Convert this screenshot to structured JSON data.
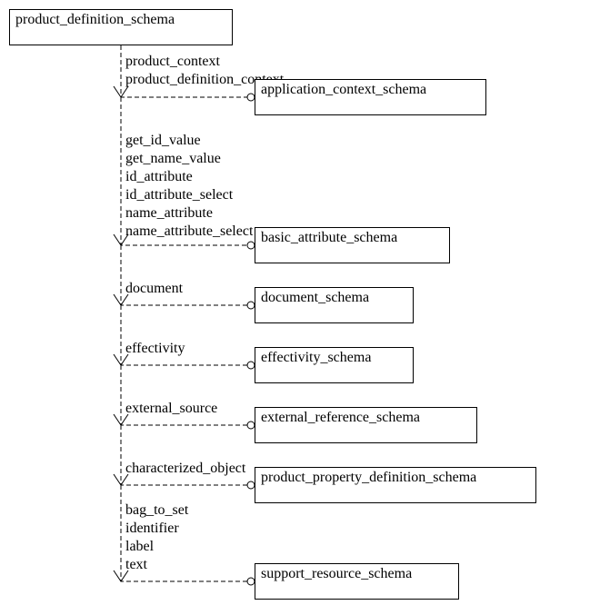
{
  "root": {
    "title": "product_definition_schema"
  },
  "groups": [
    {
      "labels": [
        "product_context",
        "product_definition_context"
      ],
      "target": "application_context_schema"
    },
    {
      "labels": [
        "get_id_value",
        "get_name_value",
        "id_attribute",
        "id_attribute_select",
        "name_attribute",
        "name_attribute_select"
      ],
      "target": "basic_attribute_schema"
    },
    {
      "labels": [
        "document"
      ],
      "target": "document_schema"
    },
    {
      "labels": [
        "effectivity"
      ],
      "target": "effectivity_schema"
    },
    {
      "labels": [
        "external_source"
      ],
      "target": "external_reference_schema"
    },
    {
      "labels": [
        "characterized_object"
      ],
      "target": "product_property_definition_schema"
    },
    {
      "labels": [
        "bag_to_set",
        "identifier",
        "label",
        "text"
      ],
      "target": "support_resource_schema"
    }
  ],
  "chart_data": {
    "type": "diagram",
    "description": "EXPRESS-G schema reference diagram",
    "source_schema": "product_definition_schema",
    "references": [
      {
        "target_schema": "application_context_schema",
        "items": [
          "product_context",
          "product_definition_context"
        ]
      },
      {
        "target_schema": "basic_attribute_schema",
        "items": [
          "get_id_value",
          "get_name_value",
          "id_attribute",
          "id_attribute_select",
          "name_attribute",
          "name_attribute_select"
        ]
      },
      {
        "target_schema": "document_schema",
        "items": [
          "document"
        ]
      },
      {
        "target_schema": "effectivity_schema",
        "items": [
          "effectivity"
        ]
      },
      {
        "target_schema": "external_reference_schema",
        "items": [
          "external_source"
        ]
      },
      {
        "target_schema": "product_property_definition_schema",
        "items": [
          "characterized_object"
        ]
      },
      {
        "target_schema": "support_resource_schema",
        "items": [
          "bag_to_set",
          "identifier",
          "label",
          "text"
        ]
      }
    ]
  }
}
